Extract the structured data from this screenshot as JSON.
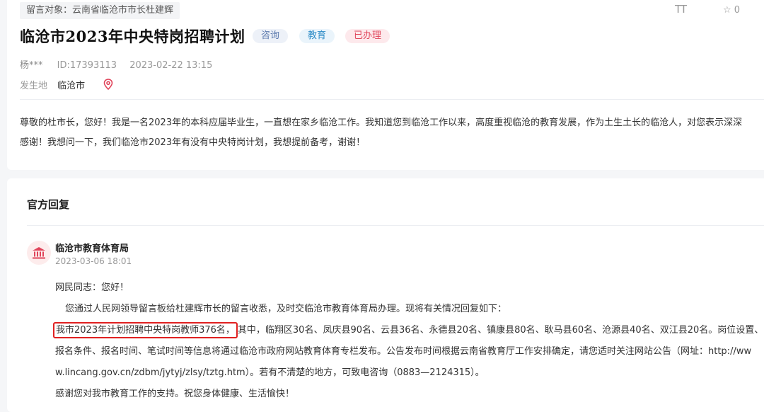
{
  "message": {
    "target": "留言对象：云南省临沧市市长杜建辉",
    "title": "临沧市2023年中央特岗招聘计划",
    "tags": [
      "咨询",
      "教育",
      "已办理"
    ],
    "author": "杨***",
    "id": "ID:17393113",
    "datetime": "2023-02-22 13:15",
    "location_label": "发生地",
    "location": "临沧市",
    "body": [
      "尊敬的杜市长，您好！我是一名2023年的本科应届毕业生，一直想在家乡临沧工作。我知道您到临沧工作以来，高度重视临沧的教育发展，作为土生土长的临沧人，对您表示深深",
      "感谢！我想问一下，我们临沧市2023年有没有中央特岗计划，我想提前备考，谢谢！"
    ]
  },
  "toolbar": {
    "font_glyph": "TT",
    "favorite_label": "☆ 0"
  },
  "reply": {
    "section_title": "官方回复",
    "org": "临沧市教育体育局",
    "date": "2023-03-06 18:01",
    "greeting": "网民同志：您好！",
    "intro": "您通过人民网领导留言板给杜建辉市长的留言收悉，及时交临沧市教育体育局办理。现将有关情况回复如下：",
    "highlight": "我市2023年计划招聘中央特岗教师376名，",
    "line3_rest": "其中，临翔区30名、凤庆县90名、云县36名、永德县20名、镇康县80名、耿马县60名、沧源县40名、双江县20名。岗位设置、",
    "line4": "报名条件、报名时间、笔试时间等信息将通过临沧市政府网站教育体育专栏发布。公告发布时间根据云南省教育厅工作安排确定，请您适时关注网站公告（网址：http://ww",
    "line5": "w.lincang.gov.cn/zdbm/jytyj/zlsy/tztg.htm）。若有不清楚的地方，可致电咨询（0883—2124315）。",
    "closing": "感谢您对我市教育工作的支持。祝您身体健康、生活愉快！"
  },
  "colors": {
    "accent_red": "#e0445a",
    "highlight_border": "#e02020",
    "tag_blue": "#2c8bc7"
  },
  "icons": [
    "location-pin-icon",
    "institution-icon",
    "font-size-icon",
    "star-icon"
  ]
}
